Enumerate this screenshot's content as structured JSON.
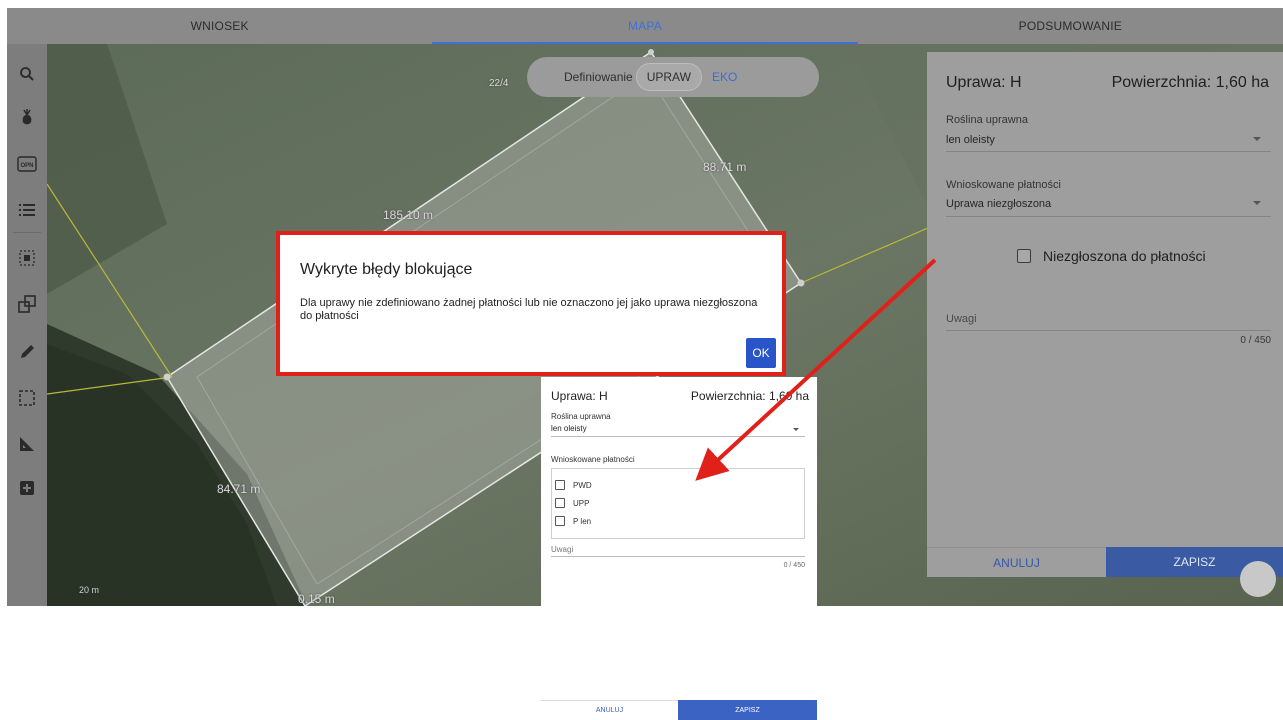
{
  "tabs": [
    {
      "label": "WNIOSEK",
      "active": false
    },
    {
      "label": "MAPA",
      "active": true
    },
    {
      "label": "PODSUMOWANIE",
      "active": false
    }
  ],
  "toolbar": {
    "tools": [
      "search-icon",
      "plant-icon",
      "opn-icon",
      "list-icon",
      "select-area-icon",
      "copy-shapes-icon",
      "pencil-icon",
      "dashed-rect-icon",
      "measure-angle-icon",
      "add-icon"
    ],
    "opn_label": "OPN"
  },
  "map": {
    "parcel_id": "22/4",
    "measure_top": "185.10 m",
    "measure_right": "88.71 m",
    "measure_left": "84.71 m",
    "measure_bottom": "0.15 m",
    "scale_label": "20 m",
    "toggle": {
      "label": "Definiowanie",
      "active": "UPRAW",
      "other": "EKO"
    }
  },
  "panel": {
    "title": "Uprawa: H",
    "area": "Powierzchnia: 1,60 ha",
    "crop_label": "Roślina uprawna",
    "crop_value": "len oleisty",
    "payments_label": "Wnioskowane płatności",
    "payments_value": "Uprawa niezgłoszona",
    "not_reported_label": "Niezgłoszona do płatności",
    "notes_label": "Uwagi",
    "counter": "0 / 450",
    "cancel": "ANULUJ",
    "save": "ZAPISZ"
  },
  "dialog": {
    "title": "Wykryte błędy blokujące",
    "body": "Dla uprawy nie zdefiniowano żadnej płatności lub nie oznaczono jej jako uprawa niezgłoszona do płatności",
    "ok": "OK"
  },
  "inset": {
    "title": "Uprawa: H",
    "area": "Powierzchnia: 1,60 ha",
    "crop_label": "Roślina uprawna",
    "crop_value": "len oleisty",
    "payments_label": "Wnioskowane płatności",
    "options": [
      "PWD",
      "UPP",
      "P len"
    ],
    "notes_label": "Uwagi",
    "counter": "0 / 450",
    "cancel": "ANULUJ",
    "save": "ZAPISZ"
  },
  "colors": {
    "accent": "#3f6fd8",
    "highlight": "#e0211a",
    "save_button": "#3a5ba4"
  }
}
